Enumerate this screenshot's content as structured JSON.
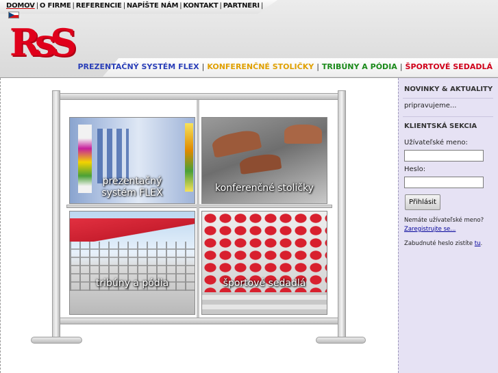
{
  "topnav": {
    "items": [
      {
        "label": "DOMOV"
      },
      {
        "label": "O FIRME"
      },
      {
        "label": "REFERENCIE"
      },
      {
        "label": "NAPÍŠTE NÁM"
      },
      {
        "label": "KONTAKT"
      },
      {
        "label": "PARTNERI"
      }
    ],
    "separator": "|"
  },
  "logo": {
    "text": "RsS",
    "color": "#e0001b"
  },
  "mainnav": {
    "items": [
      {
        "label": "PREZENTAČNÝ SYSTÉM FLEX",
        "color": "#2a3fb8"
      },
      {
        "label": "KONFERENČNÉ STOLIČKY",
        "color": "#e0a000"
      },
      {
        "label": "TRIBÚNY A PÓDIA",
        "color": "#1a8a1a"
      },
      {
        "label": "ŠPORTOVÉ SEDADLÁ",
        "color": "#d0001a"
      }
    ],
    "separator": "|"
  },
  "panels": [
    {
      "label_line1": "prezentačný",
      "label_line2": "systém FLEX"
    },
    {
      "label_line1": "konferenčné stoličky",
      "label_line2": ""
    },
    {
      "label_line1": "tribúny a pódia",
      "label_line2": ""
    },
    {
      "label_line1": "športové sedadlá",
      "label_line2": ""
    }
  ],
  "sidebar": {
    "news_title": "NOVINKY & AKTUALITY",
    "news_text": "pripravujeme...",
    "client_title": "KLIENTSKÁ SEKCIA",
    "username_label": "Užívateľské meno:",
    "username_value": "",
    "password_label": "Heslo:",
    "password_value": "",
    "login_button": "Přihlásit",
    "no_account": "Nemáte užívateľské meno?",
    "register_link": "Zaregistrujte se...",
    "forgot_text": "Zabudnuté heslo zistíte",
    "forgot_link": "tu",
    "forgot_end": "."
  }
}
